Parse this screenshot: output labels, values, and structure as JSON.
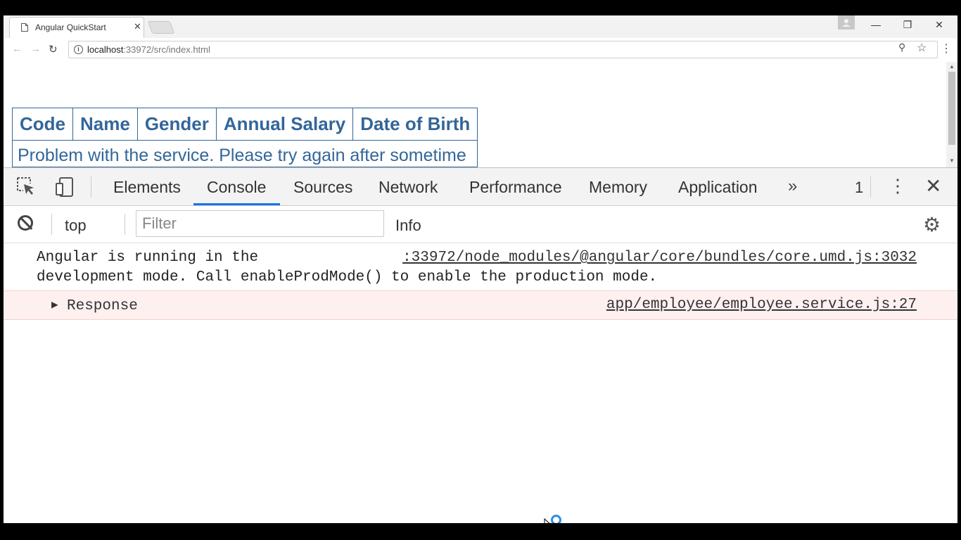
{
  "browser": {
    "tab_title": "Angular QuickStart",
    "tab_close": "✕",
    "url_host": "localhost",
    "url_path": ":33972/src/index.html",
    "window_minimize": "—",
    "window_restore": "❐",
    "window_close": "✕"
  },
  "page": {
    "table": {
      "headers": [
        "Code",
        "Name",
        "Gender",
        "Annual Salary",
        "Date of Birth"
      ],
      "error_message": "Problem with the service. Please try again after sometime"
    }
  },
  "devtools": {
    "tabs": [
      "Elements",
      "Console",
      "Sources",
      "Network",
      "Performance",
      "Memory",
      "Application"
    ],
    "active_tab": "Console",
    "overflow": "»",
    "message_count": "1",
    "context": "top",
    "filter_placeholder": "Filter",
    "level": "Info",
    "messages": [
      {
        "text_line1": "Angular is running in the",
        "text_line2": "development mode. Call enableProdMode() to enable the production mode.",
        "source": ":33972/node_modules/@angular/core/bundles/core.umd.js:3032"
      },
      {
        "text": "Response",
        "source": "app/employee/employee.service.js:27",
        "type": "error"
      }
    ]
  },
  "colors": {
    "table_accent": "#336699",
    "devtools_active_tab": "#1a73e8",
    "error_row_bg": "#fff0f0"
  }
}
